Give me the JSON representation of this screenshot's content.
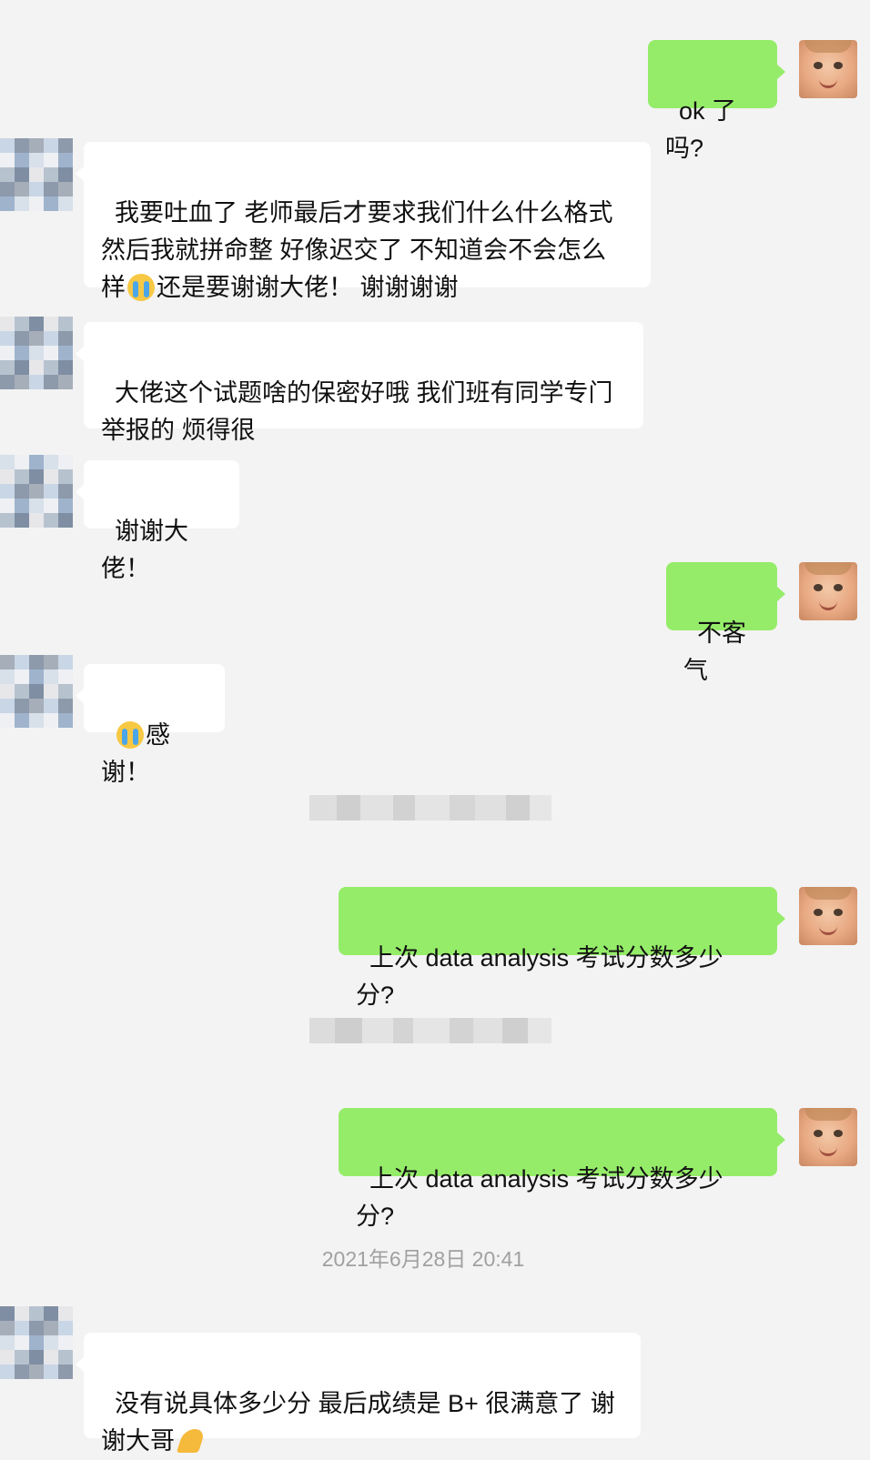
{
  "messages": [
    {
      "side": "out",
      "text": "ok 了吗?"
    },
    {
      "side": "in",
      "text_a": "我要吐血了 老师最后才要求我们什么什么格式\n然后我就拼命整 好像迟交了 不知道会不会怎么\n样",
      "emoji": "loudly-crying-face-icon",
      "text_b": "还是要谢谢大佬！ 谢谢谢谢"
    },
    {
      "side": "in",
      "text": "大佬这个试题啥的保密好哦 我们班有同学专门\n举报的 烦得很"
    },
    {
      "side": "in",
      "text": "谢谢大佬！"
    },
    {
      "side": "out",
      "text": "不客气"
    },
    {
      "side": "in",
      "emoji": "loudly-crying-face-icon",
      "text": "感谢！"
    },
    {
      "side": "out",
      "text": "上次 data analysis 考试分数多少分?"
    },
    {
      "side": "out",
      "text": "上次 data analysis 考试分数多少分?"
    },
    {
      "side": "in",
      "text": "没有说具体多少分 最后成绩是 B+ 很满意了 谢\n谢大哥",
      "emoji": "folded-hands-icon"
    }
  ],
  "timestamp": "2021年6月28日 20:41",
  "colors": {
    "background": "#f3f3f3",
    "incoming_bubble": "#ffffff",
    "outgoing_bubble": "#95ec69"
  }
}
